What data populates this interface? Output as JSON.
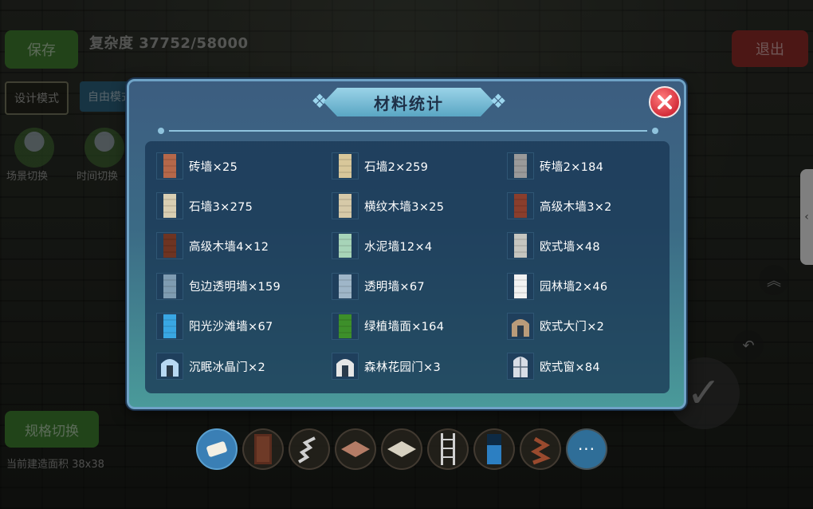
{
  "hud": {
    "save_label": "保存",
    "complexity": "复杂度 37752/58000",
    "exit_label": "退出",
    "mode_design": "设计模式",
    "mode_free": "自由模式",
    "scene_switch": "场景切换",
    "time_switch": "时间切换",
    "spec_switch": "规格切换",
    "build_area": "当前建造面积 38x38"
  },
  "modal": {
    "title": "材料统计",
    "items": [
      {
        "label": "砖墙×25",
        "icon": "brick-wall-icon",
        "color": "#b5684a"
      },
      {
        "label": "石墙2×259",
        "icon": "stone-wall-icon",
        "color": "#d8c79a"
      },
      {
        "label": "砖墙2×184",
        "icon": "grey-brick-wall-icon",
        "color": "#9a9a9a"
      },
      {
        "label": "石墙3×275",
        "icon": "stone-wall-icon",
        "color": "#d9cfb3"
      },
      {
        "label": "横纹木墙3×25",
        "icon": "wood-wall-icon",
        "color": "#d6c9a8"
      },
      {
        "label": "高级木墙3×2",
        "icon": "wood-wall-icon",
        "color": "#8a3e2c"
      },
      {
        "label": "高级木墙4×12",
        "icon": "wood-wall-icon",
        "color": "#6e3422"
      },
      {
        "label": "水泥墙12×4",
        "icon": "cement-wall-icon",
        "color": "#a7d4b8"
      },
      {
        "label": "欧式墙×48",
        "icon": "european-wall-icon",
        "color": "#c6c6c0"
      },
      {
        "label": "包边透明墙×159",
        "icon": "glass-wall-icon",
        "color": "#7f9cb2"
      },
      {
        "label": "透明墙×67",
        "icon": "glass-wall-icon",
        "color": "#9fb6c8"
      },
      {
        "label": "园林墙2×46",
        "icon": "garden-wall-icon",
        "color": "#f2f2f2"
      },
      {
        "label": "阳光沙滩墙×67",
        "icon": "beach-wall-icon",
        "color": "#39a7e4"
      },
      {
        "label": "绿植墙面×164",
        "icon": "plant-wall-icon",
        "color": "#3d8f2a"
      },
      {
        "label": "欧式大门×2",
        "icon": "european-gate-icon",
        "color": "#b99b7a"
      },
      {
        "label": "沉眠冰晶门×2",
        "icon": "ice-crystal-door-icon",
        "color": "#b8d8f2"
      },
      {
        "label": "森林花园门×3",
        "icon": "forest-garden-door-icon",
        "color": "#e6e6e6"
      },
      {
        "label": "欧式窗×84",
        "icon": "european-window-icon",
        "color": "#d8dde6"
      }
    ]
  },
  "toolbar": {
    "items": [
      "eraser-icon",
      "wood-door-tool-icon",
      "spiral-stair-tool-icon",
      "floor-tile-tool-icon",
      "stone-floor-tool-icon",
      "ladder-tool-icon",
      "glass-pane-tool-icon",
      "spiral-stair-wood-tool-icon"
    ],
    "more_label": "···"
  },
  "colors": {
    "accent": "#3a7fb5",
    "modal_border": "#6fa3c7",
    "close": "#d42e3b"
  }
}
